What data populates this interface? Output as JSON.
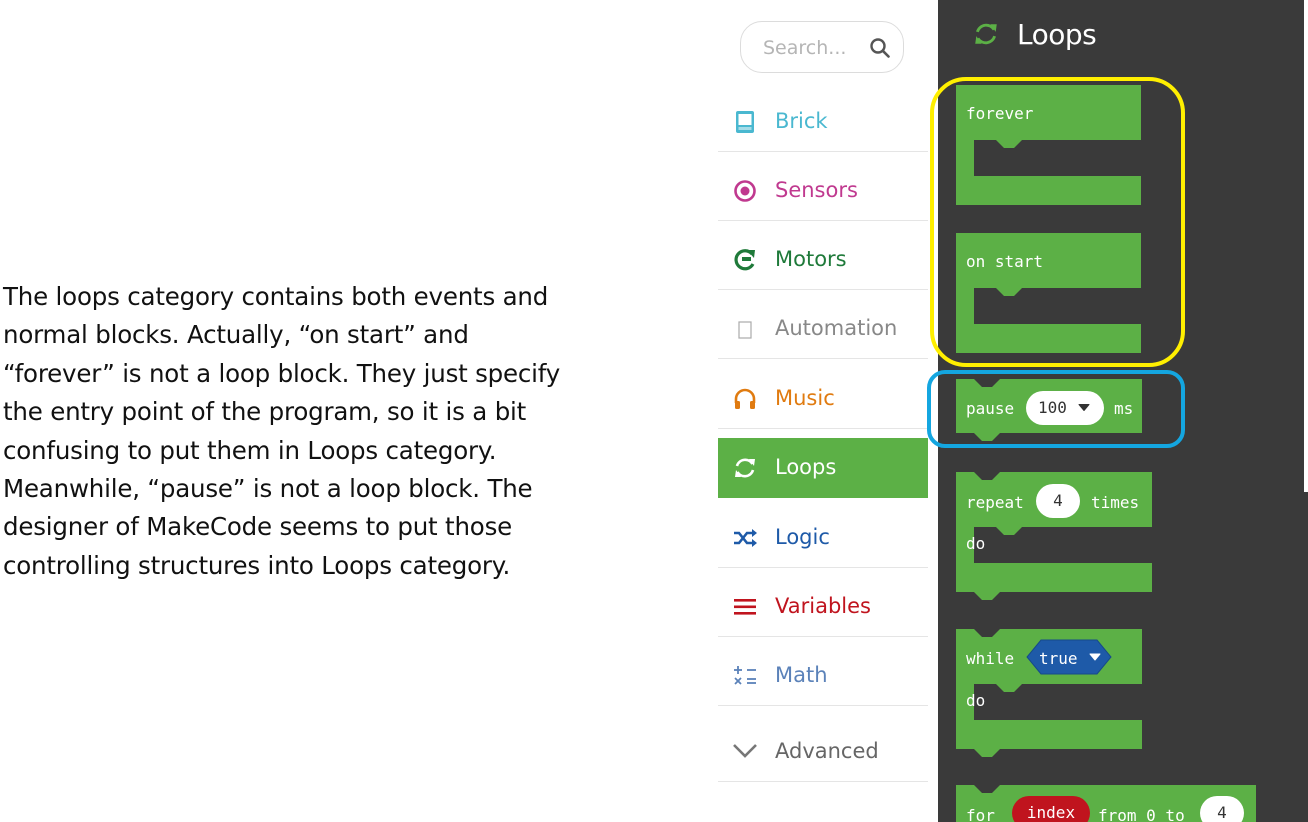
{
  "explanation": {
    "paragraph1": "The loops category contains both events and normal blocks. Actually, “on start” and “forever” is not a loop block. They just specify the entry point of the program, so it is a bit confusing to put them in Loops category.",
    "paragraph2": "Meanwhile, “pause” is not a loop block. The designer of MakeCode seems to put those controlling structures into Loops category."
  },
  "toolbox": {
    "search_placeholder": "Search...",
    "categories": [
      {
        "label": "Brick",
        "icon": "brick-icon",
        "color": "#4ab8d0"
      },
      {
        "label": "Sensors",
        "icon": "sensor-icon",
        "color": "#c0398f"
      },
      {
        "label": "Motors",
        "icon": "motor-icon",
        "color": "#1f7a3a"
      },
      {
        "label": "Automation",
        "icon": "automation-icon",
        "color": "#888888"
      },
      {
        "label": "Music",
        "icon": "headphones-icon",
        "color": "#e07b10"
      },
      {
        "label": "Loops",
        "icon": "loops-icon",
        "color": "#5cb046",
        "selected": true
      },
      {
        "label": "Logic",
        "icon": "shuffle-icon",
        "color": "#1e5aa8"
      },
      {
        "label": "Variables",
        "icon": "list-icon",
        "color": "#c0141e"
      },
      {
        "label": "Math",
        "icon": "calculator-icon",
        "color": "#5b82b9"
      },
      {
        "label": "Advanced",
        "icon": "chevron-down-icon",
        "color": "#666666"
      }
    ]
  },
  "flyout": {
    "title": "Loops",
    "block_color": "#5cb046",
    "blocks": {
      "forever": {
        "label": "forever"
      },
      "on_start": {
        "label": "on start"
      },
      "pause": {
        "label": "pause",
        "value": "100",
        "unit": "ms"
      },
      "repeat": {
        "label": "repeat",
        "count": "4",
        "suffix": "times",
        "do": "do"
      },
      "while": {
        "label": "while",
        "condition": "true",
        "do": "do"
      },
      "for": {
        "label": "for",
        "variable": "index",
        "from": "from 0 to",
        "to": "4"
      }
    }
  },
  "highlights": {
    "event_blocks_color": "#ffef00",
    "pause_block_color": "#14a6e0"
  }
}
